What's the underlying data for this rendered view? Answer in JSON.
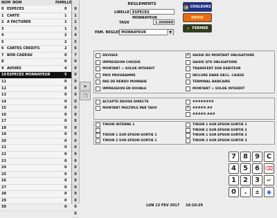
{
  "list": {
    "headers": {
      "num": "NUM",
      "name": "NOM",
      "family": "FAMILLE"
    },
    "rows": [
      {
        "num": "0",
        "name": "ESPECES",
        "family": "0"
      },
      {
        "num": "1",
        "name": "CARTE",
        "family": "1"
      },
      {
        "num": "2",
        "name": "A FACTURER",
        "family": "1"
      },
      {
        "num": "3",
        "name": "",
        "family": "1"
      },
      {
        "num": "4",
        "name": "",
        "family": "2"
      },
      {
        "num": "5",
        "name": "",
        "family": "2"
      },
      {
        "num": "6",
        "name": "CARTES CREDITS",
        "family": "2"
      },
      {
        "num": "7",
        "name": "BON CADEAU",
        "family": "0"
      },
      {
        "num": "8",
        "name": "",
        "family": "0"
      },
      {
        "num": "9",
        "name": "AVOIRS",
        "family": "4"
      },
      {
        "num": "10",
        "name": "ESPECES MONNAYEUR",
        "family": "5"
      },
      {
        "num": "11",
        "name": "",
        "family": "0"
      },
      {
        "num": "12",
        "name": "",
        "family": "0"
      },
      {
        "num": "13",
        "name": "",
        "family": "0"
      },
      {
        "num": "14",
        "name": "",
        "family": "0"
      },
      {
        "num": "15",
        "name": "",
        "family": "0"
      },
      {
        "num": "16",
        "name": "",
        "family": "0"
      },
      {
        "num": "17",
        "name": "",
        "family": "0"
      },
      {
        "num": "18",
        "name": "",
        "family": "0"
      },
      {
        "num": "19",
        "name": "",
        "family": "0"
      },
      {
        "num": "20",
        "name": "",
        "family": "0"
      },
      {
        "num": "21",
        "name": "",
        "family": "0"
      },
      {
        "num": "22",
        "name": "",
        "family": "0"
      },
      {
        "num": "23",
        "name": "",
        "family": "0"
      },
      {
        "num": "24",
        "name": "",
        "family": "0"
      },
      {
        "num": "25",
        "name": "",
        "family": "0"
      },
      {
        "num": "26",
        "name": "",
        "family": "0"
      },
      {
        "num": "27",
        "name": "",
        "family": "0"
      },
      {
        "num": "28",
        "name": "",
        "family": "0"
      },
      {
        "num": "29",
        "name": "",
        "family": "0"
      },
      {
        "num": "30",
        "name": "",
        "family": "0"
      }
    ],
    "selected_index": 10,
    "side_values": [
      "0",
      "1",
      "2",
      "3",
      "4",
      "5",
      "6",
      "7",
      "0",
      "0",
      "0",
      "0",
      "0",
      "0",
      "0",
      "0",
      "0",
      "0",
      "0",
      "0",
      "0",
      "0",
      "0",
      "0",
      "0",
      "0",
      "0",
      "0",
      "0",
      "0",
      "0",
      "0"
    ]
  },
  "form": {
    "title": "REGLEMENTS",
    "libelle_label": "LIBELLE",
    "libelle_value": "ESPECES MONNAYEUR",
    "taux_label": "TAUX",
    "taux_value": "1.000000",
    "fam_label": "FAM. REGLEMENTS",
    "fam_value": "MONNAYEUR"
  },
  "buttons": {
    "couleurs": "COULEURS",
    "envoi": "ENVOI",
    "fermer": "FERMER"
  },
  "options_left": [
    {
      "label": "DEVISES",
      "checked": false
    },
    {
      "label": "IMPRESSION CHEQUE",
      "checked": false
    },
    {
      "label": "MONTANT < SOLDE INTERDIT",
      "checked": false
    },
    {
      "label": "PRIX PROGRAMME",
      "checked": false
    },
    {
      "label": "PAS DE RENDU MONNAIE",
      "checked": false
    },
    {
      "label": "IMPRESSION EN DOUBLE",
      "checked": false
    }
  ],
  "options_right": [
    {
      "label": "SAISIE DU MONTANT OBLIGATOIRE",
      "checked": true
    },
    {
      "label": "SAISIE QTE OBLIGATOIRE",
      "checked": false
    },
    {
      "label": "TRANSFERT SUR DEBITEUR",
      "checked": false
    },
    {
      "label": "INCLURE DANS DECL. CAISSE",
      "checked": false
    },
    {
      "label": "TERMINAL BANCAIRE",
      "checked": false
    },
    {
      "label": "MONTANT > SOLDE INTERDIT",
      "checked": false
    }
  ],
  "decimal_left": [
    {
      "label": "ACCEPTE DEVISE DIRECTE",
      "checked": false
    },
    {
      "label": "MONTANT MULTIPLE PAR TAUX",
      "checked": false
    }
  ],
  "decimal_right": [
    {
      "label": "########",
      "checked": false
    },
    {
      "label": "#####.##",
      "checked": true
    },
    {
      "label": "#####.###",
      "checked": false
    }
  ],
  "tiroirs_left": [
    {
      "label": "TIROIR INTERNE 1",
      "checked": false
    },
    {
      "label": "",
      "checked": false
    },
    {
      "label": "TIROIR 1 SUR EPSON SORTIE 1",
      "checked": false
    },
    {
      "label": "TIROIR 2 SUR EPSON SORTIE 1",
      "checked": false
    }
  ],
  "tiroirs_right": [
    {
      "label": "TIROIR 1 SUR EPSON SORTIE 2",
      "checked": false
    },
    {
      "label": "TIROIR 2 SUR EPSON SORTIE 2",
      "checked": false
    },
    {
      "label": "TIROIR 1 SUR EPSON SORTIE 3",
      "checked": false
    },
    {
      "label": "TIROIR 2 SUR EPSON SORTIE 3",
      "checked": false
    }
  ],
  "keypad": {
    "keys": [
      "7",
      "8",
      "9",
      "C",
      "4",
      "5",
      "6",
      "",
      "1",
      "2",
      "3",
      "",
      "0",
      ".",
      "",
      ""
    ]
  },
  "status": {
    "date": "LUN 13 FEV 2017",
    "time": "10:10:29"
  },
  "colors": {
    "couleurs_bg": "#1e2f8c",
    "envoi_bg": "#e86a14",
    "fermer_bg": "#2f3b1a",
    "selected_row": "#111111"
  }
}
